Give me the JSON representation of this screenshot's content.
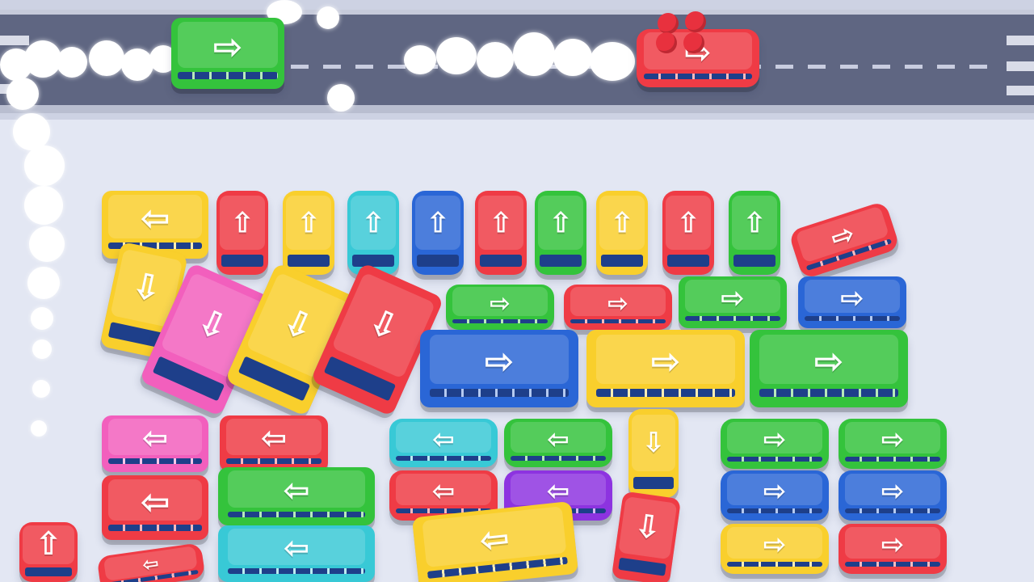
{
  "game": {
    "colors": {
      "red": "#ef3b45",
      "yellow": "#f9cf2c",
      "cyan": "#38c9d6",
      "blue": "#2a66d6",
      "green": "#34c33c",
      "pink": "#f25fbd",
      "purple": "#8d33e0",
      "road": "#5f6682",
      "lot": "#e3e7f3"
    },
    "arrow_glyphs": {
      "up": "⇧",
      "down": "⇩",
      "left": "⇦",
      "right": "⇨"
    },
    "vehicles": [
      {
        "id": "road-bus",
        "type": "bus",
        "color": "green",
        "direction": "right"
      },
      {
        "id": "road-car",
        "type": "car",
        "color": "red",
        "direction": "right"
      },
      {
        "id": "bus-row1-left",
        "type": "bus",
        "color": "yellow",
        "direction": "left"
      },
      {
        "id": "car-row1-1",
        "type": "car",
        "color": "red",
        "direction": "up"
      },
      {
        "id": "car-row1-2",
        "type": "car",
        "color": "yellow",
        "direction": "up"
      },
      {
        "id": "car-row1-3",
        "type": "car",
        "color": "cyan",
        "direction": "up"
      },
      {
        "id": "car-row1-4",
        "type": "car",
        "color": "blue",
        "direction": "up"
      },
      {
        "id": "car-row1-5",
        "type": "car",
        "color": "red",
        "direction": "up"
      },
      {
        "id": "car-row1-6",
        "type": "car",
        "color": "green",
        "direction": "up"
      },
      {
        "id": "car-row1-7",
        "type": "car",
        "color": "yellow",
        "direction": "up"
      },
      {
        "id": "car-row1-8",
        "type": "car",
        "color": "red",
        "direction": "up"
      },
      {
        "id": "car-row1-9",
        "type": "car",
        "color": "green",
        "direction": "up"
      },
      {
        "id": "car-row1-tilted",
        "type": "car",
        "color": "red",
        "direction": "right"
      },
      {
        "id": "bus-yellow-down",
        "type": "bus",
        "color": "yellow",
        "direction": "down"
      },
      {
        "id": "bus-pink-down",
        "type": "bus",
        "color": "pink",
        "direction": "down"
      },
      {
        "id": "bus-yellow-down-2",
        "type": "bus",
        "color": "yellow",
        "direction": "down"
      },
      {
        "id": "bus-red-down",
        "type": "bus",
        "color": "red",
        "direction": "down"
      },
      {
        "id": "car-green-right",
        "type": "car",
        "color": "green",
        "direction": "right"
      },
      {
        "id": "car-red-right",
        "type": "car",
        "color": "red",
        "direction": "right"
      },
      {
        "id": "bus-green-right-small",
        "type": "bus",
        "color": "green",
        "direction": "right"
      },
      {
        "id": "bus-blue-right-small",
        "type": "bus",
        "color": "blue",
        "direction": "right"
      },
      {
        "id": "bus-blue-right",
        "type": "bus",
        "color": "blue",
        "direction": "right"
      },
      {
        "id": "bus-yellow-right",
        "type": "bus",
        "color": "yellow",
        "direction": "right"
      },
      {
        "id": "bus-green-right",
        "type": "bus",
        "color": "green",
        "direction": "right"
      },
      {
        "id": "bus-pink-left",
        "type": "bus",
        "color": "pink",
        "direction": "left"
      },
      {
        "id": "bus-red-left",
        "type": "bus",
        "color": "red",
        "direction": "left"
      },
      {
        "id": "bus-red-left-2",
        "type": "bus",
        "color": "red",
        "direction": "left"
      },
      {
        "id": "bus-green-left",
        "type": "bus",
        "color": "green",
        "direction": "left"
      },
      {
        "id": "bus-cyan-left",
        "type": "bus",
        "color": "cyan",
        "direction": "left"
      },
      {
        "id": "car-cyan-left",
        "type": "car",
        "color": "cyan",
        "direction": "left"
      },
      {
        "id": "car-green-left",
        "type": "car",
        "color": "green",
        "direction": "left"
      },
      {
        "id": "car-red-left",
        "type": "car",
        "color": "red",
        "direction": "left"
      },
      {
        "id": "car-purple-left",
        "type": "car",
        "color": "purple",
        "direction": "left"
      },
      {
        "id": "car-yellow-down",
        "type": "car",
        "color": "yellow",
        "direction": "down"
      },
      {
        "id": "bus-red-down-2",
        "type": "bus",
        "color": "red",
        "direction": "down"
      },
      {
        "id": "bus-yellow-left",
        "type": "bus",
        "color": "yellow",
        "direction": "left"
      },
      {
        "id": "car-green-right-2",
        "type": "car",
        "color": "green",
        "direction": "right"
      },
      {
        "id": "car-green-right-3",
        "type": "car",
        "color": "green",
        "direction": "right"
      },
      {
        "id": "car-blue-right",
        "type": "car",
        "color": "blue",
        "direction": "right"
      },
      {
        "id": "car-blue-right-2",
        "type": "car",
        "color": "blue",
        "direction": "right"
      },
      {
        "id": "car-yellow-right",
        "type": "car",
        "color": "yellow",
        "direction": "right"
      },
      {
        "id": "car-red-right-2",
        "type": "car",
        "color": "red",
        "direction": "right"
      },
      {
        "id": "car-red-up-bottom",
        "type": "car",
        "color": "red",
        "direction": "up"
      },
      {
        "id": "car-red-left-bottom",
        "type": "car",
        "color": "red",
        "direction": "left"
      }
    ]
  }
}
